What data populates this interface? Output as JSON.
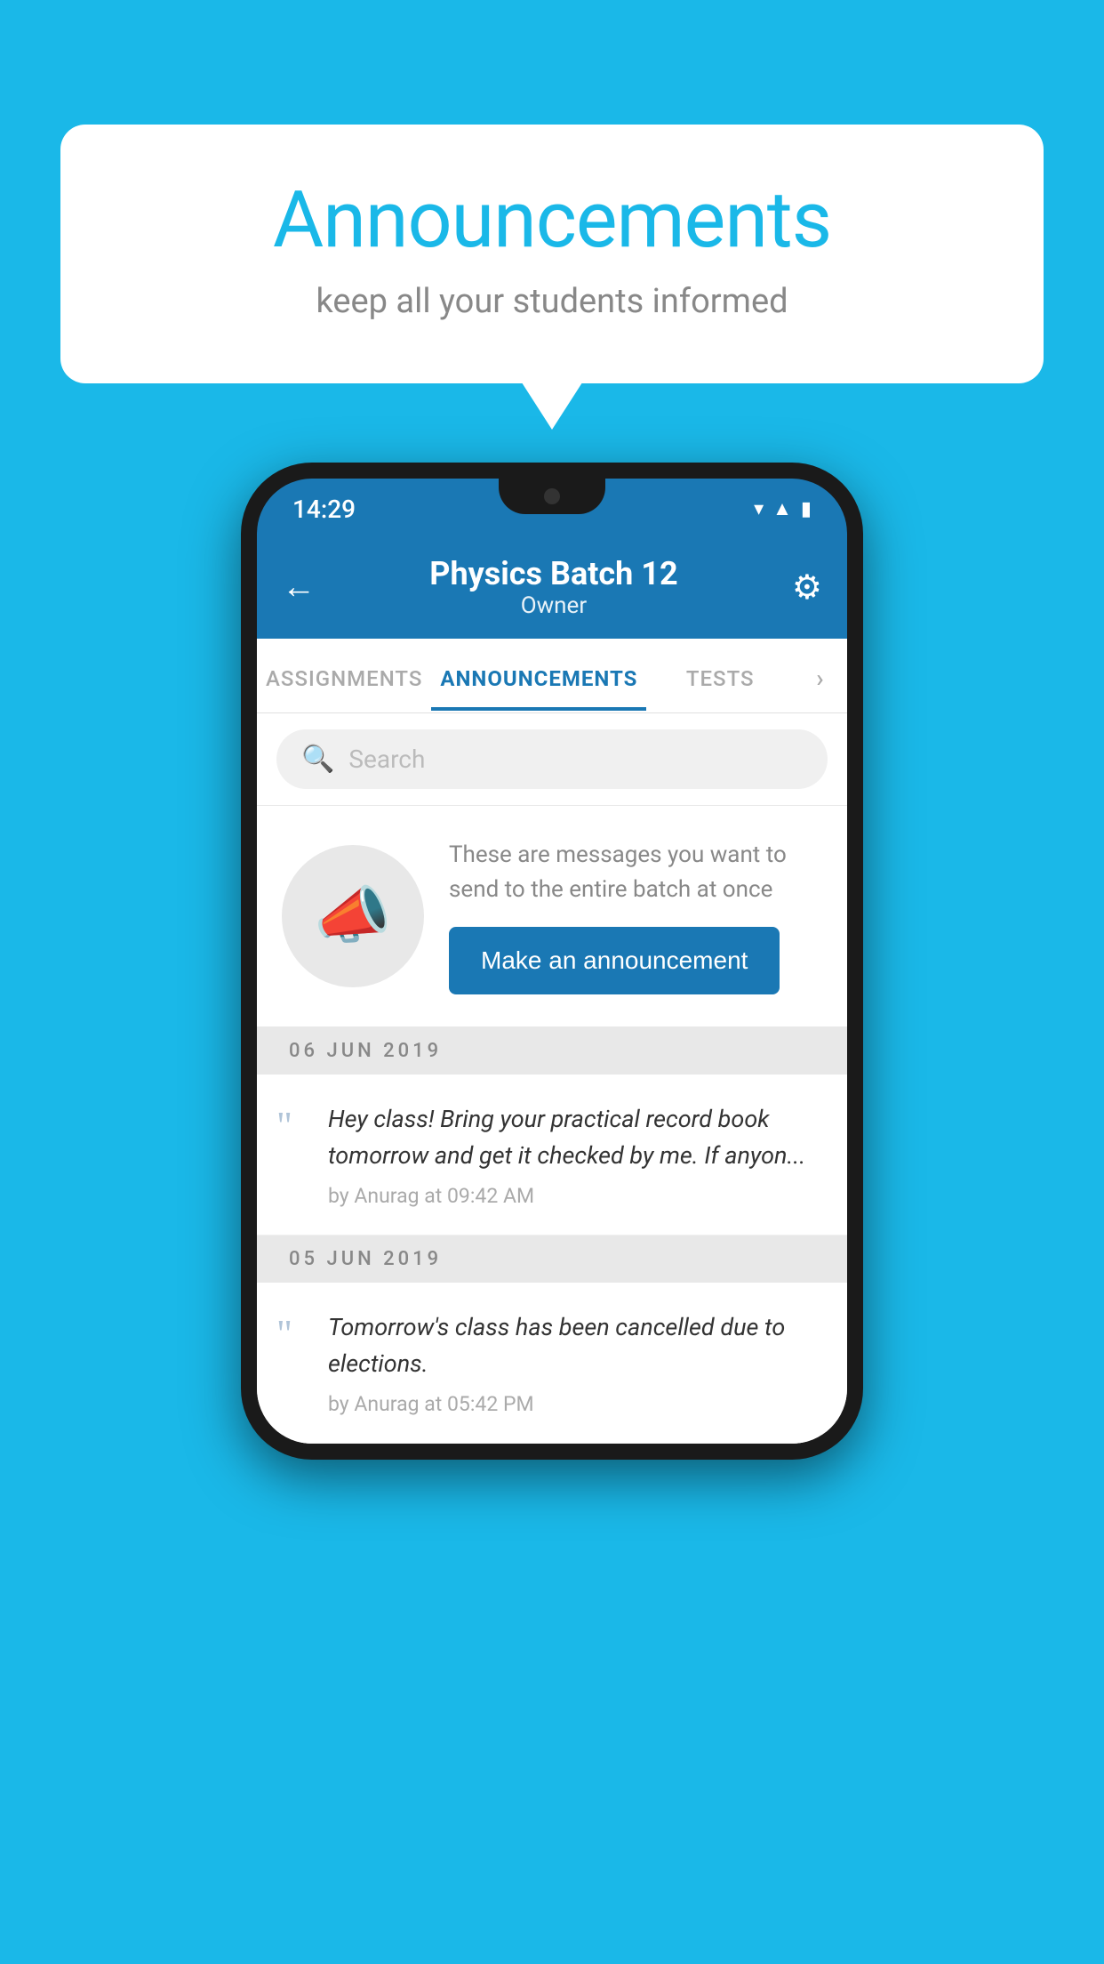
{
  "background_color": "#1ab8e8",
  "speech_bubble": {
    "title": "Announcements",
    "subtitle": "keep all your students informed"
  },
  "phone": {
    "status_bar": {
      "time": "14:29",
      "icons": [
        "wifi",
        "signal",
        "battery"
      ]
    },
    "header": {
      "title": "Physics Batch 12",
      "subtitle": "Owner",
      "back_label": "←",
      "gear_label": "⚙"
    },
    "tabs": [
      {
        "label": "ASSIGNMENTS",
        "active": false
      },
      {
        "label": "ANNOUNCEMENTS",
        "active": true
      },
      {
        "label": "TESTS",
        "active": false
      },
      {
        "label": "...",
        "active": false
      }
    ],
    "search": {
      "placeholder": "Search"
    },
    "promo": {
      "description": "These are messages you want to send to the entire batch at once",
      "button_label": "Make an announcement"
    },
    "announcements": [
      {
        "date": "06  JUN  2019",
        "text": "Hey class! Bring your practical record book tomorrow and get it checked by me. If anyon...",
        "meta": "by Anurag at 09:42 AM"
      },
      {
        "date": "05  JUN  2019",
        "text": "Tomorrow's class has been cancelled due to elections.",
        "meta": "by Anurag at 05:42 PM"
      }
    ]
  }
}
